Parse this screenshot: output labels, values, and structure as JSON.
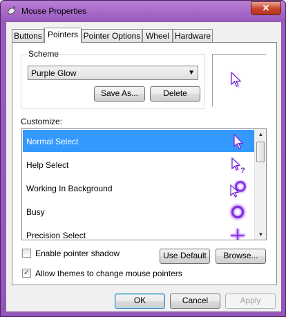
{
  "window": {
    "title": "Mouse Properties",
    "close_glyph": "✕"
  },
  "tabs": [
    {
      "label": "Buttons",
      "active": false
    },
    {
      "label": "Pointers",
      "active": true
    },
    {
      "label": "Pointer Options",
      "active": false
    },
    {
      "label": "Wheel",
      "active": false
    },
    {
      "label": "Hardware",
      "active": false
    }
  ],
  "scheme": {
    "label": "Scheme",
    "selected": "Purple Glow",
    "save_as_label": "Save As...",
    "delete_label": "Delete"
  },
  "customize": {
    "label": "Customize:",
    "items": [
      {
        "label": "Normal Select",
        "selected": true,
        "cursor_icon": "arrow-cursor-icon"
      },
      {
        "label": "Help Select",
        "selected": false,
        "cursor_icon": "help-cursor-icon"
      },
      {
        "label": "Working In Background",
        "selected": false,
        "cursor_icon": "working-cursor-icon"
      },
      {
        "label": "Busy",
        "selected": false,
        "cursor_icon": "busy-cursor-icon"
      },
      {
        "label": "Precision Select",
        "selected": false,
        "cursor_icon": "crosshair-cursor-icon"
      }
    ]
  },
  "options": {
    "enable_shadow_label": "Enable pointer shadow",
    "enable_shadow_checked": false,
    "allow_themes_label": "Allow themes to change mouse pointers",
    "allow_themes_checked": true,
    "use_default_label": "Use Default",
    "browse_label": "Browse..."
  },
  "footer": {
    "ok_label": "OK",
    "cancel_label": "Cancel",
    "apply_label": "Apply"
  },
  "colors": {
    "cursor_purple": "#7b2fd9",
    "cursor_glow": "#b36bff",
    "selection_blue": "#3399ff",
    "titlebar_purple": "#9556ba"
  }
}
